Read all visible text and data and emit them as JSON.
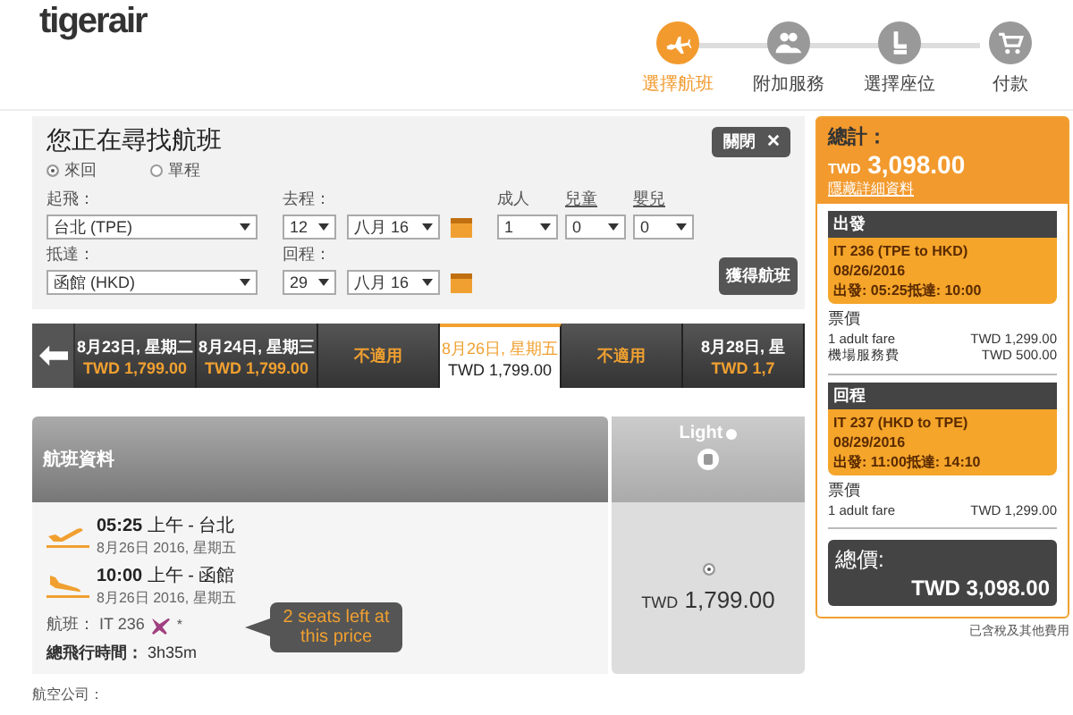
{
  "logo": {
    "text": "tigerair"
  },
  "steps": [
    {
      "label": "選擇航班",
      "selected": true
    },
    {
      "label": "附加服務",
      "selected": false
    },
    {
      "label": "選擇座位",
      "selected": false
    },
    {
      "label": "付款",
      "selected": false
    }
  ],
  "search": {
    "title": "您正在尋找航班",
    "close_button": "關閉",
    "trip_types": [
      {
        "label": "來回",
        "selected": true
      },
      {
        "label": "單程",
        "selected": false
      }
    ],
    "from_label": "起飛：",
    "from_value": "台北 (TPE)",
    "to_label": "抵達：",
    "to_value": "函館 (HKD)",
    "depart_label": "去程：",
    "depart_day": "12",
    "depart_month": "八月 16",
    "return_label": "回程：",
    "return_day": "29",
    "return_month": "八月 16",
    "pax": [
      {
        "label": "成人",
        "value": "1"
      },
      {
        "label": "兒童",
        "value": "0"
      },
      {
        "label": "嬰兒",
        "value": "0"
      }
    ],
    "search_button": "獲得航班"
  },
  "dates": [
    {
      "date": "8月23日, 星期二",
      "price": "TWD 1,799.00",
      "selected": false
    },
    {
      "date": "8月24日, 星期三",
      "price": "TWD 1,799.00",
      "selected": false
    },
    {
      "date": "不適用",
      "selected": false
    },
    {
      "date": "8月26日, 星期五",
      "price": "TWD 1,799.00",
      "selected": true
    },
    {
      "date": "不適用",
      "selected": false
    },
    {
      "date": "8月28日, 星",
      "price": "TWD 1,7",
      "selected": false
    }
  ],
  "flight": {
    "header": "航班資料",
    "fare_name": "Light",
    "segments": [
      {
        "kind": "depart",
        "time": "05:25",
        "ampm": "上午",
        "city": "- 台北",
        "date": "8月26日 2016, 星期五"
      },
      {
        "kind": "arrive",
        "time": "10:00",
        "ampm": "上午",
        "city": "- 函館",
        "date": "8月26日 2016, 星期五"
      }
    ],
    "flight_no_label": "航班：",
    "flight_no": "IT 236",
    "asterisk": "*",
    "duration_label": "總飛行時間：",
    "duration": "3h35m",
    "tooltip": "2 seats left at this price",
    "fare_currency": "TWD",
    "fare_amount": "1,799.00",
    "fare_selected": true
  },
  "airline_label": "航空公司：",
  "summary": {
    "total_label": "總計：",
    "currency": "TWD",
    "total": "3,098.00",
    "details_link": "隱藏詳細資料",
    "legs": [
      {
        "title": "出發",
        "flight": "IT 236 (TPE to HKD)",
        "date": "08/26/2016",
        "times": "出發: 05:25抵達: 10:00",
        "fare_label": "票價",
        "lines": [
          {
            "name": "1 adult fare",
            "amount": "TWD 1,299.00"
          },
          {
            "name": "機場服務費",
            "amount": "TWD 500.00"
          }
        ]
      },
      {
        "title": "回程",
        "flight": "IT 237 (HKD to TPE)",
        "date": "08/29/2016",
        "times": "出發: 11:00抵達: 14:10",
        "fare_label": "票價",
        "lines": [
          {
            "name": "1 adult fare",
            "amount": "TWD 1,299.00"
          }
        ]
      }
    ],
    "grand_label": "總價:",
    "grand_total": "TWD 3,098.00",
    "note": "已含稅及其他費用"
  }
}
